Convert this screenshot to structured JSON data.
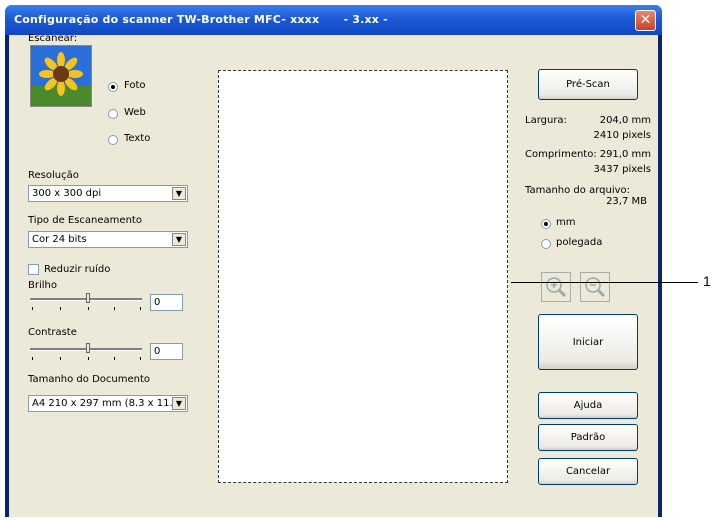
{
  "window": {
    "title": "Configuração do scanner TW-Brother MFC- xxxx      - 3.xx -",
    "close_glyph": "✕"
  },
  "scan": {
    "label": "Escanear:",
    "options": [
      {
        "label": "Foto",
        "selected": true
      },
      {
        "label": "Web",
        "selected": false
      },
      {
        "label": "Texto",
        "selected": false
      }
    ]
  },
  "resolution": {
    "label": "Resolução",
    "value": "300 x 300 dpi"
  },
  "scan_type": {
    "label": "Tipo de Escaneamento",
    "value": "Cor 24 bits"
  },
  "noise": {
    "label": "Reduzir ruído",
    "checked": false
  },
  "brightness": {
    "label": "Brilho",
    "value": "0"
  },
  "contrast": {
    "label": "Contraste",
    "value": "0"
  },
  "doc_size": {
    "label": "Tamanho do Documento",
    "value": "A4 210 x 297 mm (8.3 x 11."
  },
  "right": {
    "prescan_label": "Pré-Scan",
    "width_label": "Largura:",
    "width_mm": "204,0 mm",
    "width_px": "2410 pixels",
    "length_label": "Comprimento:",
    "length_mm": "291,0 mm",
    "length_px": "3437 pixels",
    "filesize_label": "Tamanho do arquivo:",
    "filesize_value": "23,7 MB",
    "units": [
      {
        "label": "mm",
        "selected": true
      },
      {
        "label": "polegada",
        "selected": false
      }
    ],
    "start_label": "Iniciar",
    "help_label": "Ajuda",
    "default_label": "Padrão",
    "cancel_label": "Cancelar"
  },
  "callout": {
    "number": "1"
  }
}
